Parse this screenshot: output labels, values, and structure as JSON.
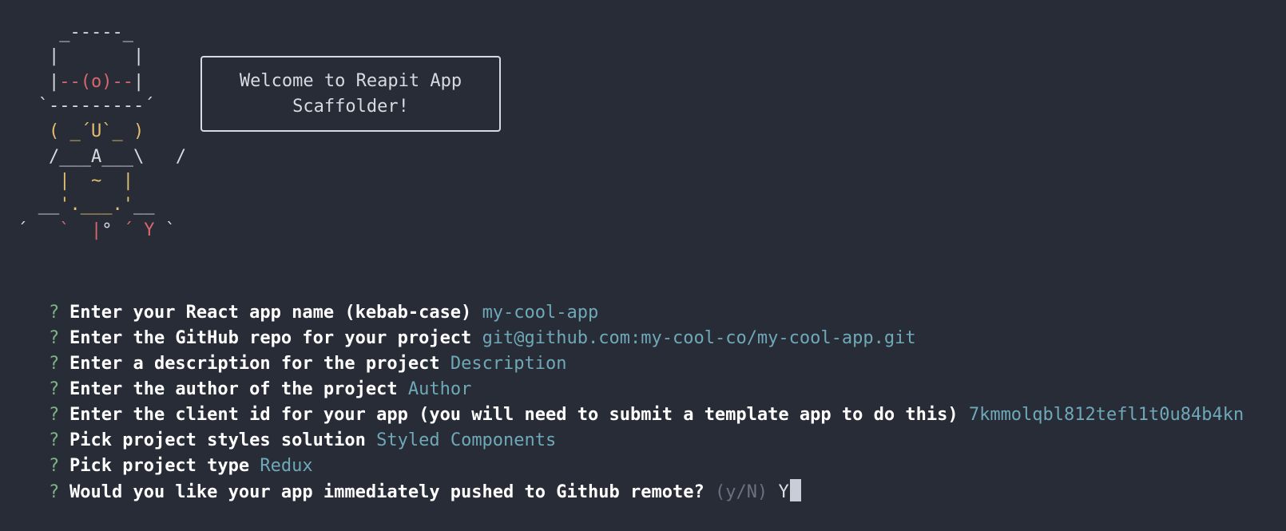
{
  "ascii_art": {
    "lines": [
      [
        {
          "text": "     _-----_",
          "color": "white"
        }
      ],
      [
        {
          "text": "    |       |",
          "color": "white"
        }
      ],
      [
        {
          "text": "    |",
          "color": "white"
        },
        {
          "text": "--(o)--",
          "color": "red"
        },
        {
          "text": "|",
          "color": "white"
        }
      ],
      [
        {
          "text": "   `---------´",
          "color": "white"
        }
      ],
      [
        {
          "text": "    ( ",
          "color": "yellow"
        },
        {
          "text": "_´U`_",
          "color": "yellow"
        },
        {
          "text": " )",
          "color": "yellow"
        }
      ],
      [
        {
          "text": "    /___A___\\   /",
          "color": "white"
        }
      ],
      [
        {
          "text": "     ",
          "color": "white"
        },
        {
          "text": "|  ~  |",
          "color": "yellow"
        }
      ],
      [
        {
          "text": "   __",
          "color": "white"
        },
        {
          "text": "'.___.'",
          "color": "yellow"
        },
        {
          "text": "__",
          "color": "white"
        }
      ],
      [
        {
          "text": " ´   ",
          "color": "white"
        },
        {
          "text": "`  ",
          "color": "red"
        },
        {
          "text": "|",
          "color": "red"
        },
        {
          "text": "° ",
          "color": "white"
        },
        {
          "text": "´ Y",
          "color": "red"
        },
        {
          "text": " `",
          "color": "white"
        }
      ]
    ]
  },
  "welcome_box": {
    "line1": "Welcome to Reapit App",
    "line2": "Scaffolder!"
  },
  "prompts": [
    {
      "question": "Enter your React app name (kebab-case)",
      "answer": "my-cool-app"
    },
    {
      "question": "Enter the GitHub repo for your project",
      "answer": "git@github.com:my-cool-co/my-cool-app.git"
    },
    {
      "question": "Enter a description for the project",
      "answer": "Description"
    },
    {
      "question": "Enter the author of the project",
      "answer": "Author"
    },
    {
      "question": "Enter the client id for your app (you will need to submit a template app to do this)",
      "answer": "7kmmolqbl812tefl1t0u84b4kn"
    },
    {
      "question": "Pick project styles solution",
      "answer": "Styled Components"
    },
    {
      "question": "Pick project type",
      "answer": "Redux"
    }
  ],
  "active_prompt": {
    "question": "Would you like your app immediately pushed to Github remote?",
    "hint": "(y/N)",
    "typed": "Y"
  },
  "prompt_marker": "?",
  "colors": {
    "background": "#282c37",
    "question_mark": "#7fb38a",
    "answer": "#6fa8b8",
    "hint": "#6b7180",
    "ascii_red": "#d8666e",
    "ascii_yellow": "#e2bf6f"
  }
}
